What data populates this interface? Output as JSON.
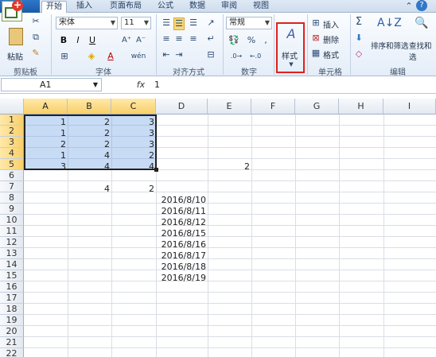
{
  "tabs": [
    {
      "label": "开始",
      "active": true
    },
    {
      "label": "插入"
    },
    {
      "label": "页面布局"
    },
    {
      "label": "公式"
    },
    {
      "label": "数据"
    },
    {
      "label": "审阅"
    },
    {
      "label": "视图"
    }
  ],
  "ribbon": {
    "clipboard": {
      "label": "剪贴板",
      "paste": "粘贴"
    },
    "font": {
      "label": "字体",
      "family": "宋体",
      "size": "11",
      "bold": "B",
      "italic": "I",
      "underline": "U"
    },
    "alignment": {
      "label": "对齐方式"
    },
    "number": {
      "label": "数字",
      "format": "常规",
      "percent": "%",
      "comma": ","
    },
    "styles": {
      "label": "样式"
    },
    "cells": {
      "label": "单元格",
      "insert": "插入",
      "delete": "删除",
      "format": "格式"
    },
    "editing": {
      "label": "编辑",
      "sort_filter": "排序和筛选",
      "find_select": "查找和选"
    }
  },
  "formula_bar": {
    "name_box": "A1",
    "fx": "fx",
    "content": "1"
  },
  "columns": [
    "A",
    "B",
    "C",
    "D",
    "E",
    "F",
    "G",
    "H",
    "I"
  ],
  "rows": [
    "1",
    "2",
    "3",
    "4",
    "5",
    "6",
    "7",
    "8",
    "9",
    "10",
    "11",
    "12",
    "13",
    "14",
    "15",
    "16",
    "17",
    "18",
    "19",
    "20",
    "21",
    "22"
  ],
  "cells": {
    "r1": [
      "1",
      "2",
      "3"
    ],
    "r2": [
      "1",
      "2",
      "3"
    ],
    "r3": [
      "2",
      "2",
      "3"
    ],
    "r4": [
      "1",
      "4",
      "2"
    ],
    "r5": [
      "3",
      "4",
      "4"
    ],
    "e5": "2",
    "b7": "4",
    "c7": "2",
    "dates": [
      "2016/8/10",
      "2016/8/11",
      "2016/8/12",
      "2016/8/15",
      "2016/8/16",
      "2016/8/17",
      "2016/8/18",
      "2016/8/19"
    ]
  },
  "colors": {
    "selection": "#6ea0e6",
    "highlight_box": "#e02020",
    "header_selected": "#f8cf6a"
  }
}
